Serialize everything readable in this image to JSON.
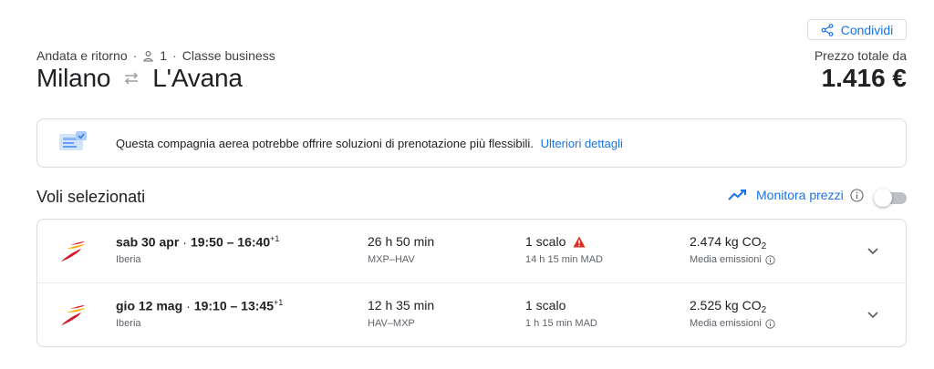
{
  "header": {
    "share_label": "Condividi",
    "trip_type": "Andata e ritorno",
    "passengers": "1",
    "cabin_class": "Classe business",
    "origin": "Milano",
    "destination": "L'Avana",
    "price_label": "Prezzo totale da",
    "price_total": "1.416 €"
  },
  "banner": {
    "text": "Questa compagnia aerea potrebbe offrire soluzioni di prenotazione più flessibili.",
    "link": "Ulteriori dettagli"
  },
  "section": {
    "title": "Voli selezionati",
    "track_label": "Monitora prezzi",
    "track_enabled": false
  },
  "flights": [
    {
      "date": "sab 30 apr",
      "times": "19:50 – 16:40",
      "day_offset": "+1",
      "airline": "Iberia",
      "duration": "26 h 50 min",
      "route": "MXP–HAV",
      "stops": "1 scalo",
      "has_warning": true,
      "layover": "14 h 15 min MAD",
      "co2_value": "2.474 kg CO",
      "co2_sub": "2",
      "emissions_label": "Media emissioni"
    },
    {
      "date": "gio 12 mag",
      "times": "19:10 – 13:45",
      "day_offset": "+1",
      "airline": "Iberia",
      "duration": "12 h 35 min",
      "route": "HAV–MXP",
      "stops": "1 scalo",
      "has_warning": false,
      "layover": "1 h 15 min MAD",
      "co2_value": "2.525 kg CO",
      "co2_sub": "2",
      "emissions_label": "Media emissioni"
    }
  ],
  "colors": {
    "accent": "#1a73e8",
    "warning": "#d93025",
    "iberia_red": "#d7192d",
    "iberia_yellow": "#fbb100"
  },
  "icons": {
    "share": "share-icon",
    "person": "person-icon",
    "swap": "swap-arrows-icon",
    "banner": "flexible-booking-icon",
    "trend": "price-trend-icon",
    "info": "info-icon",
    "warning": "warning-icon",
    "chevron": "chevron-down-icon",
    "airline": "iberia-logo"
  }
}
